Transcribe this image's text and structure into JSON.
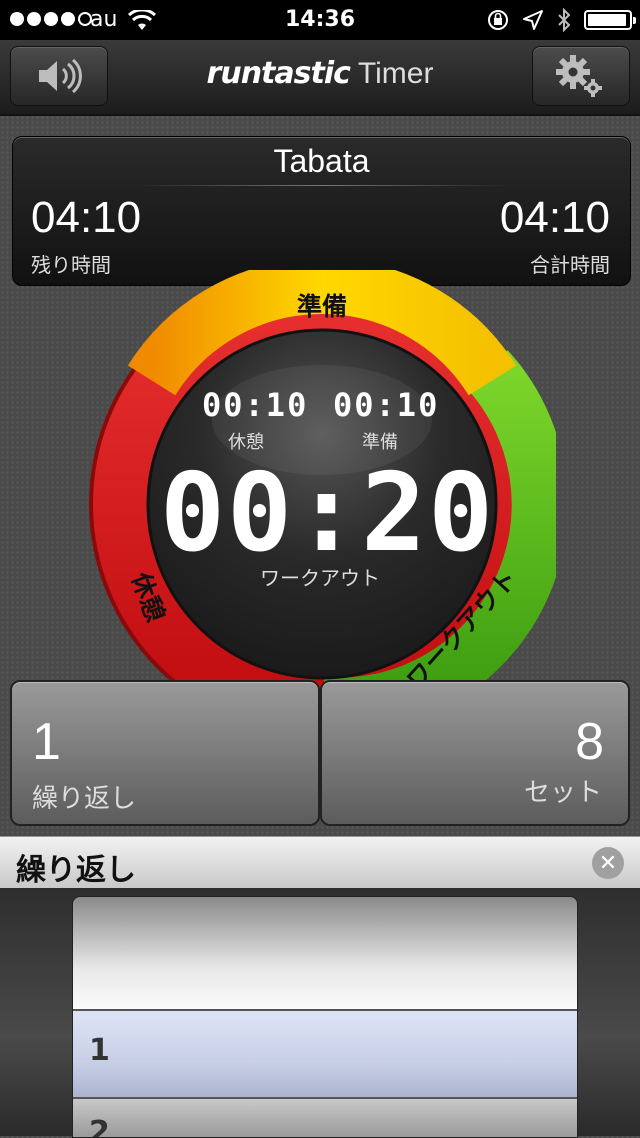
{
  "status_bar": {
    "carrier": "au",
    "time": "14:36",
    "signal_icon": "signal-dots",
    "icons": [
      "wifi-icon",
      "rotation-lock-icon",
      "location-arrow-icon",
      "bluetooth-icon",
      "battery-icon"
    ]
  },
  "nav": {
    "brand": "runtastic",
    "app_name": "Timer",
    "left_button_icon": "speaker-icon",
    "right_button_icon": "settings-gears-icon"
  },
  "info": {
    "title": "Tabata",
    "remaining_time": "04:10",
    "remaining_label": "残り時間",
    "total_time": "04:10",
    "total_label": "合計時間"
  },
  "ring": {
    "phase_top": "準備",
    "phase_left": "休憩",
    "phase_right": "ワークアウト",
    "colors": {
      "prepare": "#f5c400",
      "rest": "#d8151a",
      "workout": "#4caf18"
    }
  },
  "timers": {
    "rest_time": "00:10",
    "rest_label": "休憩",
    "prepare_time": "00:10",
    "prepare_label": "準備",
    "main_time": "00:20",
    "main_label": "ワークアウト"
  },
  "counters": {
    "repeats_value": "1",
    "repeats_label": "繰り返し",
    "sets_value": "8",
    "sets_label": "セット"
  },
  "picker": {
    "title": "繰り返し",
    "selected": "1",
    "next": "2"
  }
}
